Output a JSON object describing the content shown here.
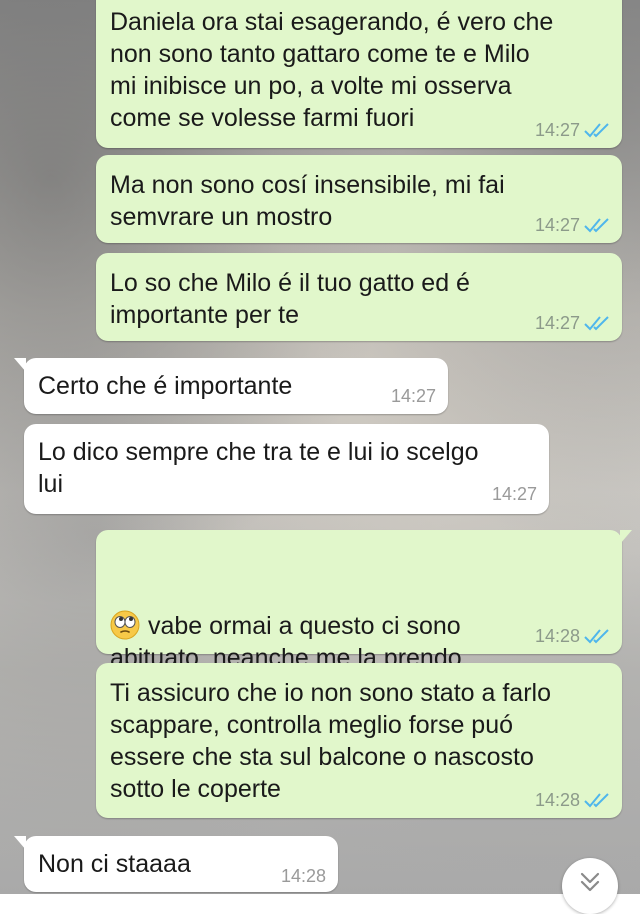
{
  "colors": {
    "outgoing_bubble": "#e1f7cb",
    "incoming_bubble": "#ffffff",
    "read_ticks": "#4fb6ec",
    "timestamp": "#8c9a8a"
  },
  "messages": [
    {
      "direction": "outgoing",
      "text": "Daniela ora stai esagerando, é vero che\nnon sono tanto gattaro come te e Milo\nmi inibisce un po, a volte mi osserva\ncome se volesse farmi fuori",
      "time": "14:27",
      "status_icon": "double-check-read-icon"
    },
    {
      "direction": "outgoing",
      "text": "Ma non sono cosí insensibile, mi fai\nsemvrare un mostro",
      "time": "14:27",
      "status_icon": "double-check-read-icon"
    },
    {
      "direction": "outgoing",
      "text": "Lo so che Milo é il tuo gatto ed é\nimportante per te",
      "time": "14:27",
      "status_icon": "double-check-read-icon"
    },
    {
      "direction": "incoming",
      "text": "Certo che é importante",
      "time": "14:27"
    },
    {
      "direction": "incoming",
      "text": "Lo dico sempre che tra te e lui io scelgo\nlui",
      "time": "14:27"
    },
    {
      "direction": "outgoing",
      "emoji": "face-with-rolling-eyes-emoji",
      "text": "vabe ormai a questo ci sono\nabituato, neanche me la prendo",
      "time": "14:28",
      "status_icon": "double-check-read-icon"
    },
    {
      "direction": "outgoing",
      "text": "Ti assicuro che io non sono stato a farlo\nscappare, controlla meglio forse puó\nessere che sta sul balcone o nascosto\nsotto le coperte",
      "time": "14:28",
      "status_icon": "double-check-read-icon"
    },
    {
      "direction": "incoming",
      "text": "Non ci staaaa",
      "time": "14:28"
    }
  ],
  "scroll_button_icon": "chevron-double-down-icon"
}
